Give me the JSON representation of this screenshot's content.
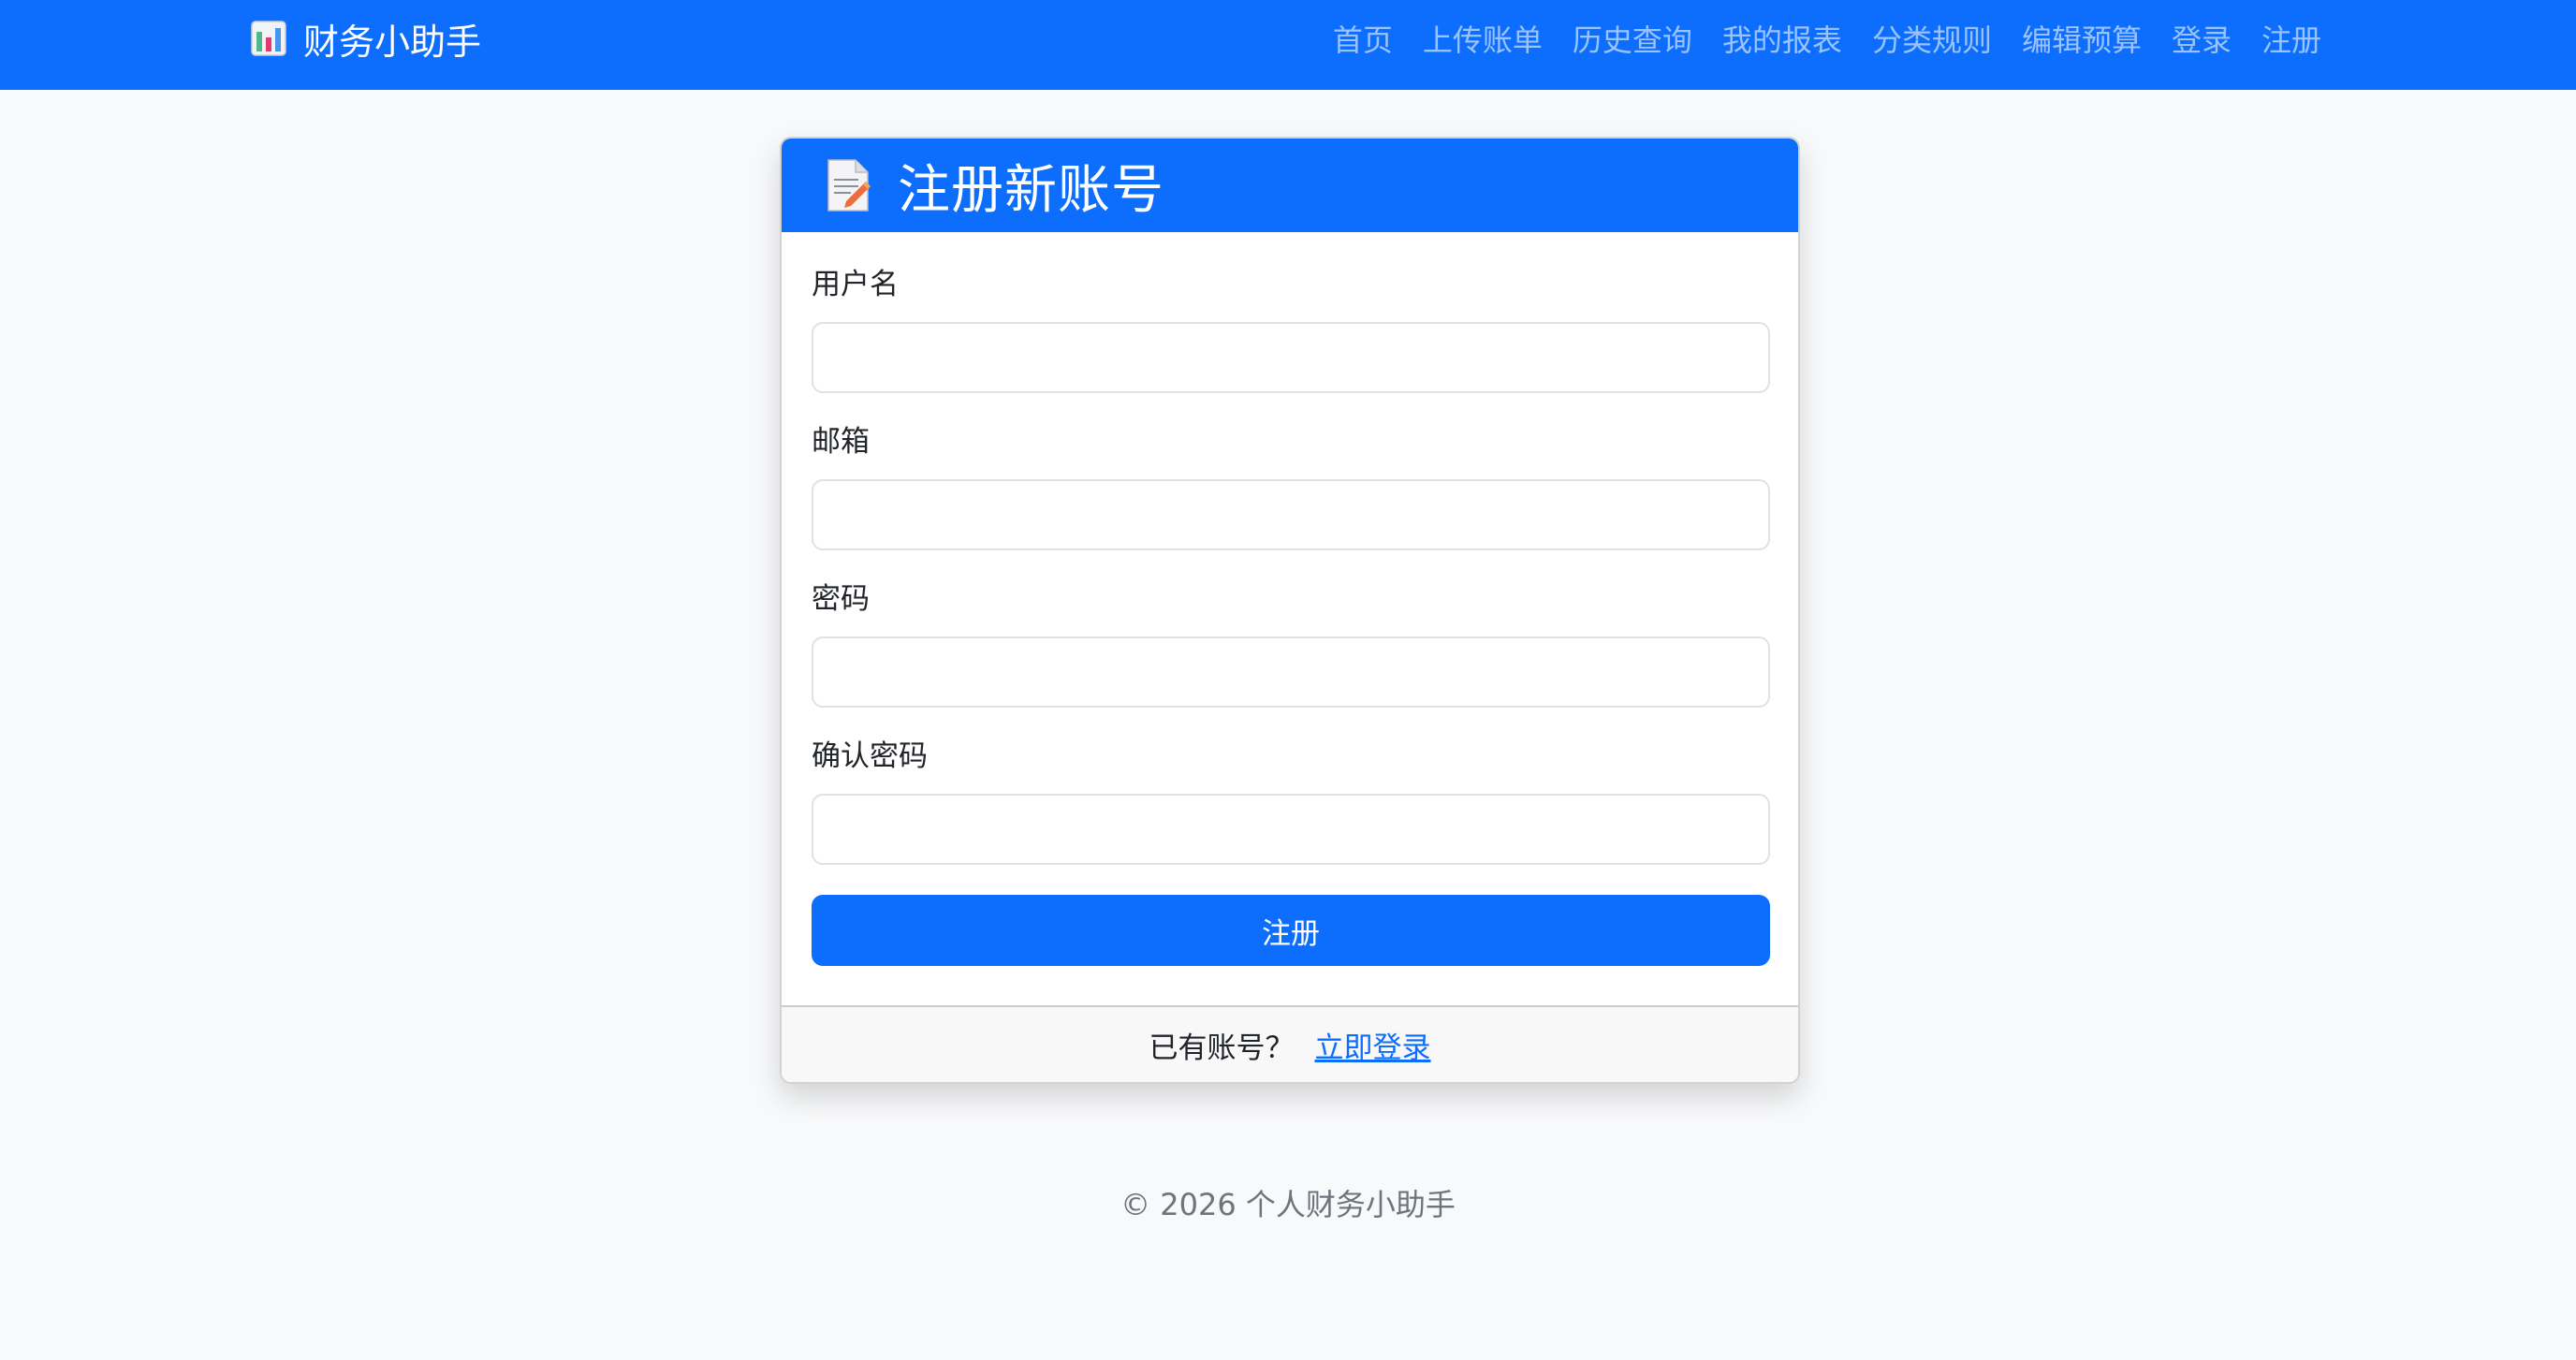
{
  "navbar": {
    "brand": "财务小助手",
    "brand_icon": "bar-chart-icon",
    "links": [
      {
        "label": "首页"
      },
      {
        "label": "上传账单"
      },
      {
        "label": "历史查询"
      },
      {
        "label": "我的报表"
      },
      {
        "label": "分类规则"
      },
      {
        "label": "编辑预算"
      },
      {
        "label": "登录"
      },
      {
        "label": "注册"
      }
    ]
  },
  "card": {
    "header_icon": "memo-icon",
    "title": "注册新账号",
    "fields": {
      "username": {
        "label": "用户名",
        "value": ""
      },
      "email": {
        "label": "邮箱",
        "value": ""
      },
      "password": {
        "label": "密码",
        "value": ""
      },
      "confirm_password": {
        "label": "确认密码",
        "value": ""
      }
    },
    "submit_label": "注册",
    "footer": {
      "question": "已有账号？",
      "link": "立即登录"
    }
  },
  "page_footer": "© 2026 个人财务小助手",
  "colors": {
    "primary": "#0d6efd",
    "background": "#f8f9fa",
    "muted_text": "#6c757d"
  }
}
